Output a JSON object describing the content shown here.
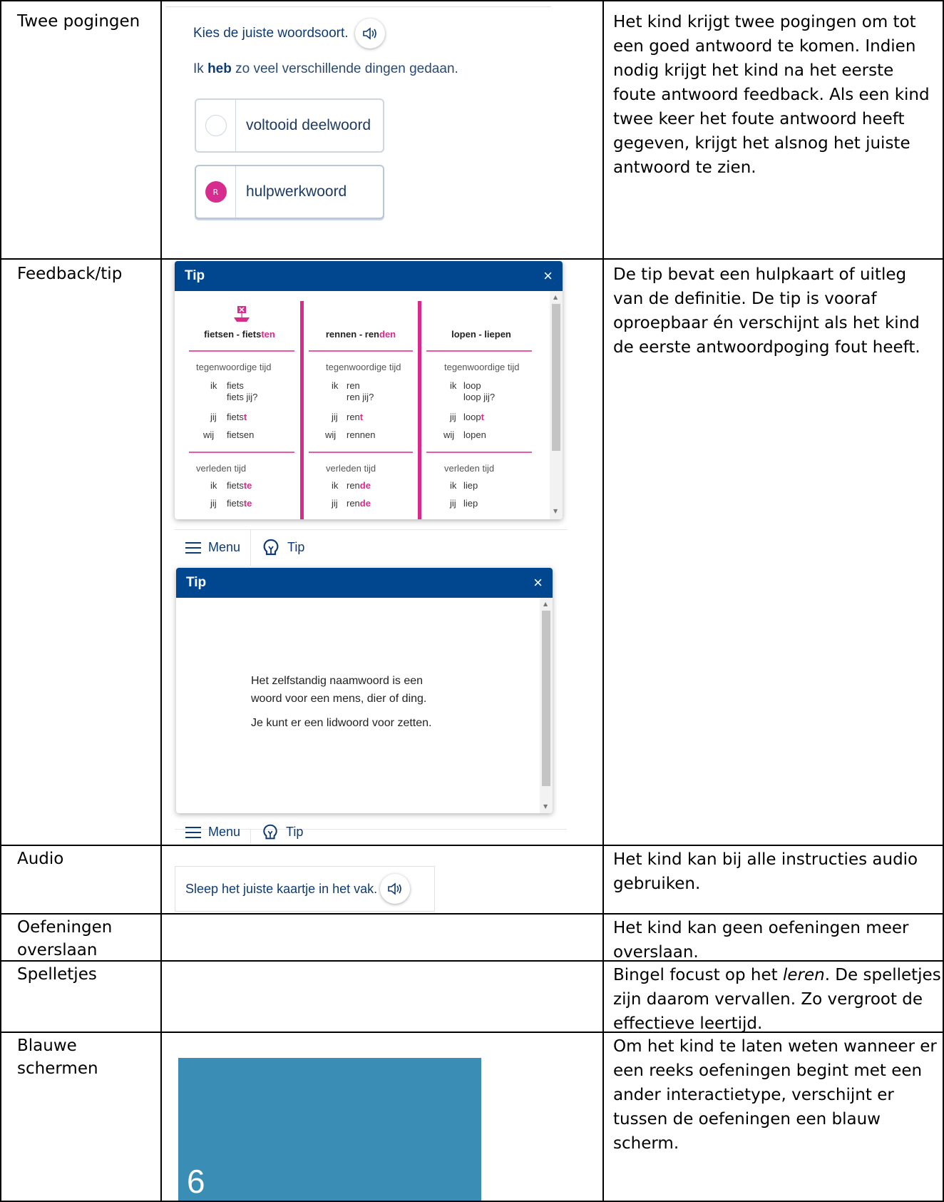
{
  "rows": [
    {
      "label": "Twee pogingen",
      "description": "Het kind krijgt twee pogingen om tot een goed antwoord te komen. Indien nodig krijgt het kind na het eerste foute antwoord feedback. Als een kind twee keer het foute antwoord heeft gegeven, krijgt het alsnog het juiste antwoord te zien."
    },
    {
      "label": "Feedback/tip",
      "description": "De tip bevat een hulpkaart of uitleg van de definitie. De tip is vooraf oproepbaar én verschijnt als het kind de eerste antwoordpoging fout heeft."
    },
    {
      "label": "Audio",
      "description": "Het kind kan bij alle instructies audio gebruiken."
    },
    {
      "label_line1": "Oefeningen",
      "label_line2": "overslaan",
      "description": "Het kind kan geen oefeningen meer overslaan."
    },
    {
      "label": "Spelletjes",
      "desc_part1": "Bingel focust op het ",
      "desc_em": "leren",
      "desc_part2": ". De spelletjes zijn daarom vervallen. Zo vergroot de effectieve leertijd."
    },
    {
      "label_line1": "Blauwe",
      "label_line2": "schermen",
      "description": "Om het kind te laten weten wanneer er een reeks oefeningen begint met een ander interactietype, verschijnt er tussen de oefeningen een blauw scherm."
    }
  ],
  "exercise": {
    "instruction": "Kies de juiste woordsoort.",
    "sentence_pre": "Ik ",
    "sentence_bold": "heb",
    "sentence_post": " zo veel verschillende dingen gedaan.",
    "options": [
      "voltooid deelwoord",
      "hulpwerkwoord"
    ],
    "selected_mark": "R"
  },
  "tip1": {
    "title": "Tip",
    "close": "×",
    "columns": [
      {
        "head_base": "fietsen - fiets",
        "head_pink": "ten",
        "present_label": "tegenwoordige tijd",
        "ik": "ik",
        "ik_val": "fiets",
        "ik_q": "fiets jij?",
        "jij": "jij",
        "jij_base": "fiets",
        "jij_pink": "t",
        "wij": "wij",
        "wij_val": "fietsen",
        "past_label": "verleden tijd",
        "past_ik_base": "fiets",
        "past_ik_pink": "te",
        "past_jij_base": "fiets",
        "past_jij_pink": "te"
      },
      {
        "head_base": "rennen - ren",
        "head_pink": "den",
        "present_label": "tegenwoordige tijd",
        "ik": "ik",
        "ik_val": "ren",
        "ik_q": "ren jij?",
        "jij": "jij",
        "jij_base": "ren",
        "jij_pink": "t",
        "wij": "wij",
        "wij_val": "rennen",
        "past_label": "verleden tijd",
        "past_ik_base": "ren",
        "past_ik_pink": "de",
        "past_jij_base": "ren",
        "past_jij_pink": "de"
      },
      {
        "head_base": "lopen - liepen",
        "head_pink": "",
        "present_label": "tegenwoordige tijd",
        "ik": "ik",
        "ik_val": "loop",
        "ik_q": "loop jij?",
        "jij": "jij",
        "jij_base": "loop",
        "jij_pink": "t",
        "wij": "wij",
        "wij_val": "lopen",
        "past_label": "verleden tijd",
        "past_ik_base": "liep",
        "past_ik_pink": "",
        "past_jij_base": "liep",
        "past_jij_pink": ""
      }
    ]
  },
  "toolbar": {
    "menu": "Menu",
    "tip": "Tip"
  },
  "tip2": {
    "title": "Tip",
    "close": "×",
    "line1": "Het zelfstandig naamwoord is een",
    "line2": "woord voor een mens, dier of ding.",
    "line3": "Je kunt er een lidwoord voor zetten."
  },
  "audio": {
    "instruction": "Sleep het juiste kaartje in het vak."
  },
  "blue_screen": {
    "number": "6",
    "color": "#3a8eb5"
  },
  "colors": {
    "tip_header": "#01478f",
    "accent_pink": "#d92b8a",
    "text_blue": "#0f3b73"
  }
}
